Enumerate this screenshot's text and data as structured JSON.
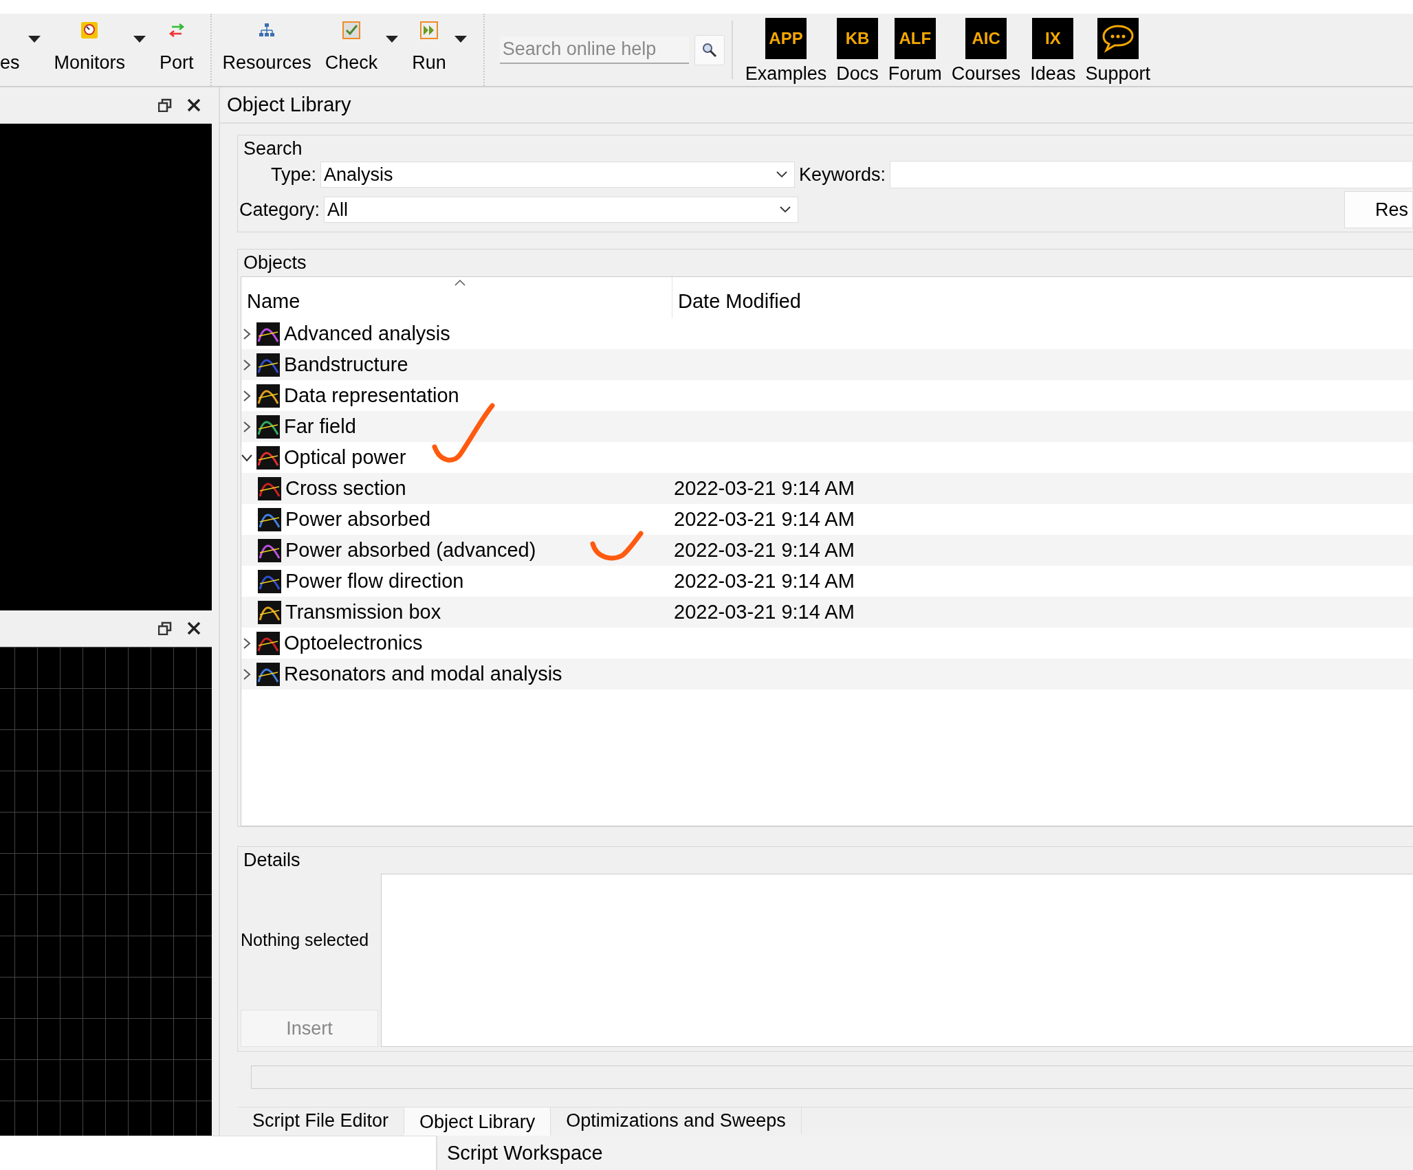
{
  "toolbar": {
    "groups": [
      [
        {
          "label": "es",
          "menu": true
        },
        {
          "label": "Monitors",
          "menu": true
        },
        {
          "label": "Port",
          "menu": false
        }
      ],
      [
        {
          "label": "Resources",
          "menu": false
        },
        {
          "label": "Check",
          "menu": true
        },
        {
          "label": "Run",
          "menu": true
        }
      ]
    ],
    "search": {
      "placeholder": "Search online help"
    },
    "links": [
      {
        "kind": "badge",
        "badge": "APP",
        "label": "Examples"
      },
      {
        "kind": "badge",
        "badge": "KB",
        "label": "Docs"
      },
      {
        "kind": "badge",
        "badge": "ALF",
        "label": "Forum"
      },
      {
        "kind": "badge",
        "badge": "AIC",
        "label": "Courses"
      },
      {
        "kind": "badge",
        "badge": "IX",
        "label": "Ideas"
      },
      {
        "kind": "chat",
        "label": "Support"
      }
    ]
  },
  "panel_title": "Object Library",
  "search_group": {
    "title": "Search",
    "type_label": "Type:",
    "type_value": "Analysis",
    "keywords_label": "Keywords:",
    "category_label": "Category:",
    "category_value": "All",
    "reset_button": "Res"
  },
  "objects": {
    "title": "Objects",
    "columns": [
      "Name",
      "Date Modified"
    ],
    "rows": [
      {
        "name": "Advanced analysis",
        "expanded": false
      },
      {
        "name": "Bandstructure",
        "expanded": false
      },
      {
        "name": "Data representation",
        "expanded": false
      },
      {
        "name": "Far field",
        "expanded": false
      },
      {
        "name": "Optical power",
        "expanded": true,
        "children": [
          {
            "name": "Cross section",
            "date": "2022-03-21 9:14 AM"
          },
          {
            "name": "Power absorbed",
            "date": "2022-03-21 9:14 AM"
          },
          {
            "name": "Power absorbed (advanced)",
            "date": "2022-03-21 9:14 AM"
          },
          {
            "name": "Power flow direction",
            "date": "2022-03-21 9:14 AM"
          },
          {
            "name": "Transmission box",
            "date": "2022-03-21 9:14 AM"
          }
        ]
      },
      {
        "name": "Optoelectronics",
        "expanded": false
      },
      {
        "name": "Resonators and modal analysis",
        "expanded": false
      }
    ]
  },
  "details": {
    "title": "Details",
    "status": "Nothing selected",
    "insert_button": "Insert"
  },
  "tabs": [
    {
      "label": "Script File Editor",
      "selected": false
    },
    {
      "label": "Object Library",
      "selected": true
    },
    {
      "label": "Optimizations and Sweeps",
      "selected": false
    }
  ],
  "bottom_panel": {
    "title": "Script Workspace"
  }
}
